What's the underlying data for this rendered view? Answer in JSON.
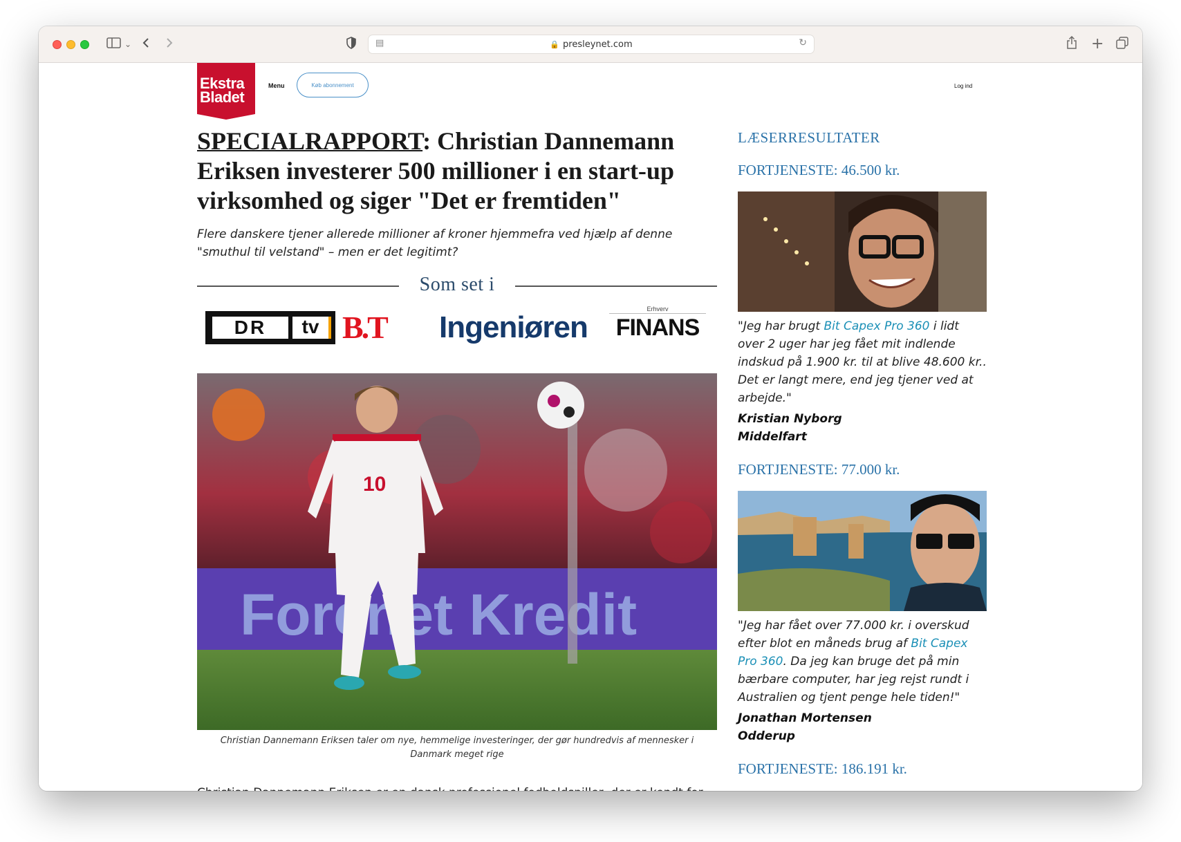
{
  "browser": {
    "url": "presleynet.com"
  },
  "site": {
    "logo_line1": "Ekstra",
    "logo_line2": "Bladet",
    "menu_label": "Menu",
    "subscribe_label": "Køb abonnement",
    "login_label": "Log ind"
  },
  "article": {
    "headline_tag": "SPECIALRAPPORT",
    "headline_rest": ": Christian Dannemann Eriksen investerer 500 millioner i en start-up virksomhed og siger \"Det er fremtiden\"",
    "subheadline": "Flere danskere tjener allerede millioner af kroner hjemmefra ved hjælp af denne \"smuthul til velstand\" – men er det legitimt?",
    "seen_in_label": "Som set i",
    "media_logos": {
      "dr": "DR",
      "tv": "tv",
      "bt": "B.T",
      "ingenioren": "Ingeniøren",
      "finans_small": "Erhverv",
      "finans": "FINANS"
    },
    "hero_banner_text": "Forenet Kredit",
    "jersey_number": "10",
    "hero_caption": "Christian Dannemann Eriksen taler om nye, hemmelige investeringer, der gør hundredvis af mennesker i Danmark meget rige",
    "body_first_line": "Christian Dannemann Eriksen er en dansk professionel fodboldspiller, der er kendt for"
  },
  "sidebar": {
    "title": "LÆSERRESULTATER",
    "testimonials": [
      {
        "profit": "FORTJENESTE: 46.500 kr.",
        "quote_before": "\"Jeg har brugt ",
        "quote_link": "Bit Capex Pro 360",
        "quote_after": " i lidt over 2 uger har jeg fået mit indlende indskud på 1.900 kr. til at blive 48.600 kr.. Det er langt mere, end jeg tjener ved at arbejde.\"",
        "name": "Kristian Nyborg",
        "city": "Middelfart"
      },
      {
        "profit": "FORTJENESTE: 77.000 kr.",
        "quote_before": "\"Jeg har fået over 77.000 kr. i overskud efter blot en måneds brug af ",
        "quote_link": "Bit Capex Pro 360",
        "quote_after": ". Da jeg kan bruge det på min bærbare computer, har jeg rejst rundt i Australien og tjent penge hele tiden!\"",
        "name": "Jonathan Mortensen",
        "city": "Odderup"
      },
      {
        "profit": "FORTJENESTE: 186.191 kr."
      }
    ]
  },
  "colors": {
    "brand_red": "#c8102e",
    "sidebar_blue": "#2a72a8",
    "link_teal": "#1a8fb6"
  }
}
